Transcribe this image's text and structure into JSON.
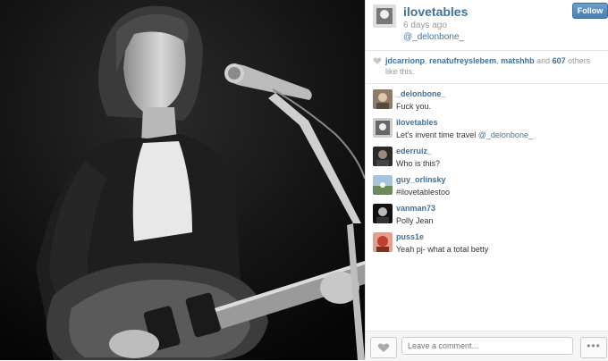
{
  "post": {
    "owner": "ilovetables",
    "time": "6 days ago",
    "tagged": "@_delonbone_",
    "follow_label": "Follow",
    "likes": {
      "names": [
        "jdcarrionp",
        "renatufreyslebem",
        "matshhb"
      ],
      "sep1": ", ",
      "sep2": ", ",
      "and_text": " and ",
      "count": "607",
      "suffix": " others like this."
    }
  },
  "comments": [
    {
      "user": "_delonbone_",
      "text": "Fuck you.",
      "mention": ""
    },
    {
      "user": "ilovetables",
      "text": "Let's invent time travel ",
      "mention": "@_delonbone_"
    },
    {
      "user": "ederruiz_",
      "text": "Who is this?",
      "mention": ""
    },
    {
      "user": "guy_orlinsky",
      "text": "#ilovetablestoo",
      "mention": ""
    },
    {
      "user": "vanman73",
      "text": "Polly Jean",
      "mention": ""
    },
    {
      "user": "puss1e",
      "text": "Yeah pj- what a total betty",
      "mention": ""
    }
  ],
  "footer": {
    "comment_placeholder": "Leave a comment...",
    "more_label": "•••"
  },
  "colors": {
    "link": "#3f729b",
    "follow_button": "#4a80b3"
  }
}
